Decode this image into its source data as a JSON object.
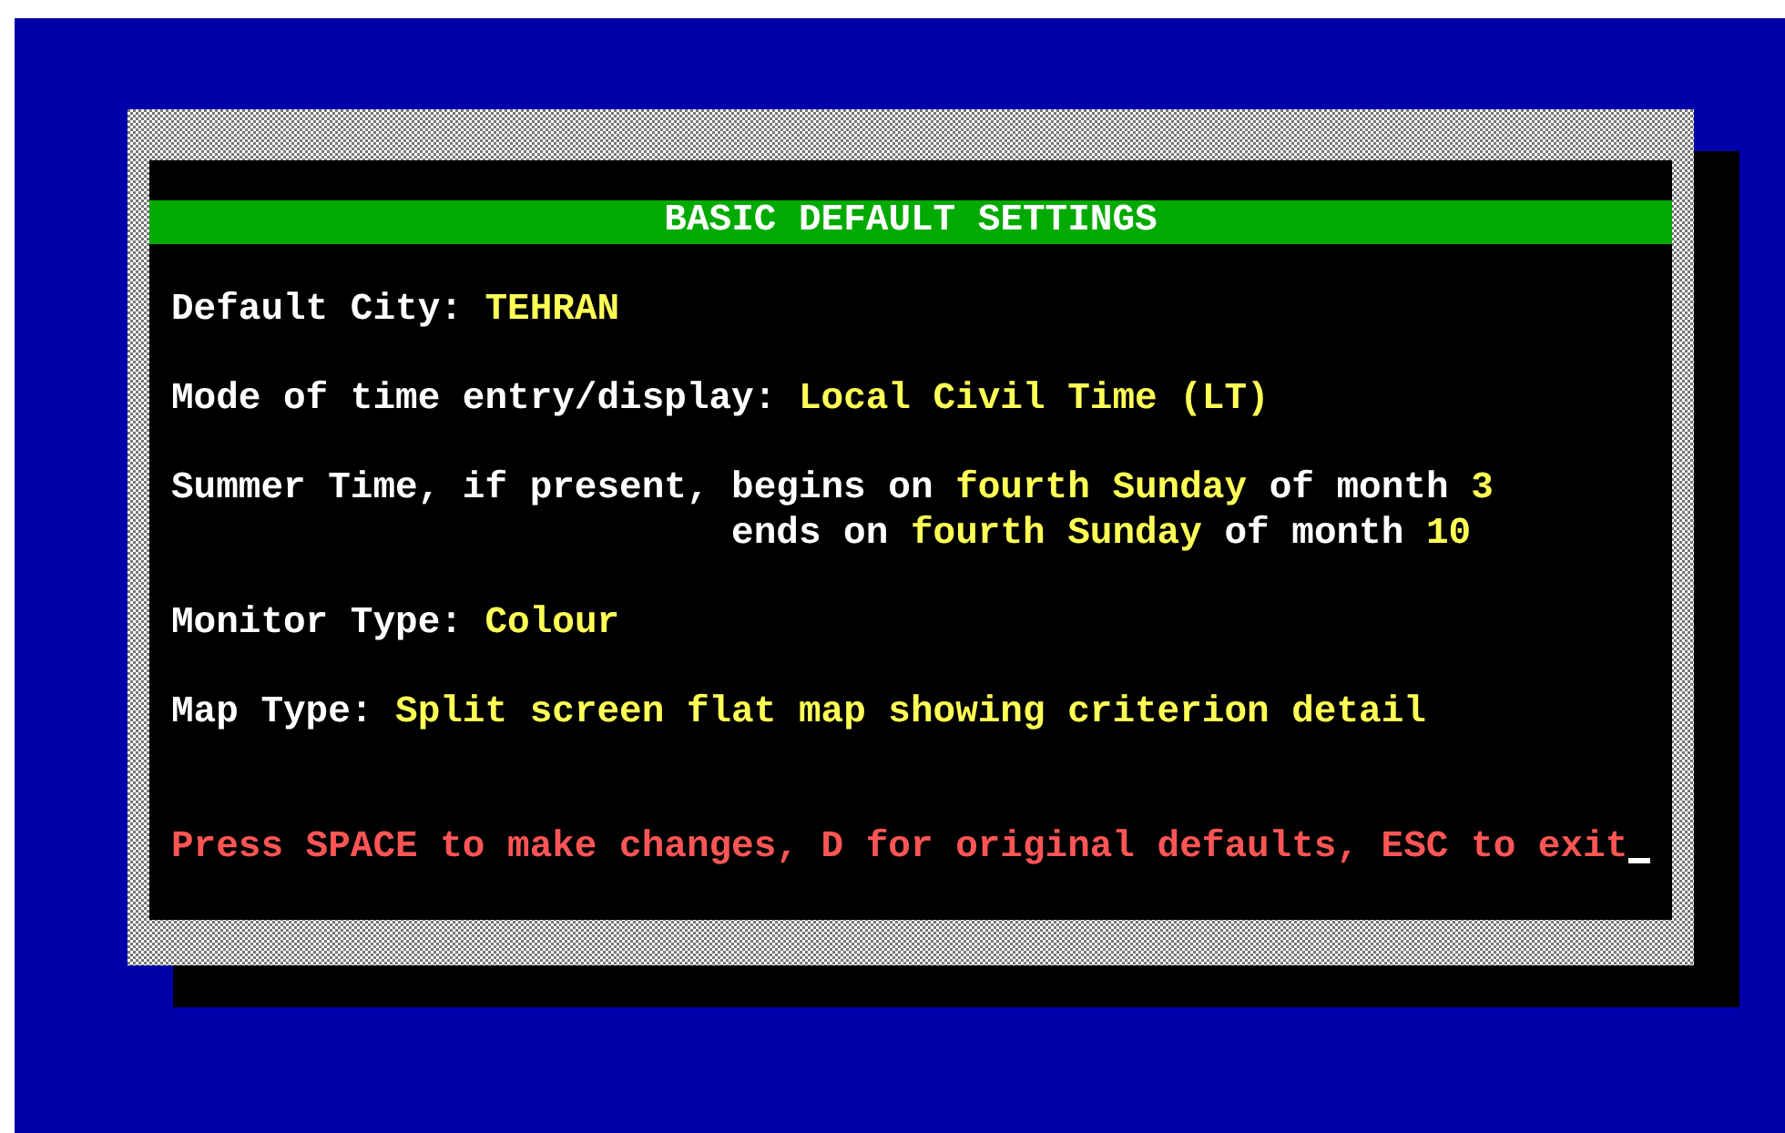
{
  "title": "BASIC DEFAULT SETTINGS",
  "settings": [
    {
      "kind": "line",
      "segments": [
        {
          "kind": "label",
          "text": "Default City:"
        },
        {
          "kind": "value",
          "text": "TEHRAN"
        }
      ]
    },
    {
      "kind": "line",
      "segments": [
        {
          "kind": "label",
          "text": "Mode of time entry/display:"
        },
        {
          "kind": "value",
          "text": "Local Civil Time (LT)"
        }
      ]
    },
    {
      "kind": "block",
      "label": "Summer Time, if present,",
      "lines": [
        [
          {
            "kind": "label",
            "text": "begins on"
          },
          {
            "kind": "value",
            "text": "fourth Sunday"
          },
          {
            "kind": "label",
            "text": "of month"
          },
          {
            "kind": "value",
            "text": "3"
          }
        ],
        [
          {
            "kind": "label",
            "text": "ends on"
          },
          {
            "kind": "value",
            "text": "fourth Sunday"
          },
          {
            "kind": "label",
            "text": "of month"
          },
          {
            "kind": "value",
            "text": "10"
          }
        ]
      ]
    },
    {
      "kind": "line",
      "segments": [
        {
          "kind": "label",
          "text": "Monitor Type:"
        },
        {
          "kind": "value",
          "text": "Colour"
        }
      ]
    },
    {
      "kind": "line",
      "segments": [
        {
          "kind": "label",
          "text": "Map Type:"
        },
        {
          "kind": "value",
          "text": "Split screen flat map showing criterion detail"
        }
      ]
    }
  ],
  "prompt": "Press SPACE to make changes, D for original defaults, ESC to exit"
}
